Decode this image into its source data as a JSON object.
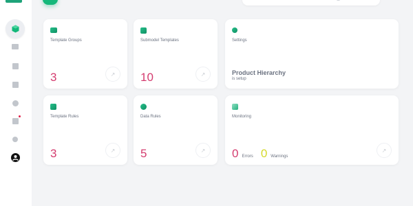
{
  "colors": {
    "accent": "#14b87a",
    "count": "#d43c6f",
    "warning": "#d4d92a"
  },
  "sidebar": {
    "items": [
      {
        "icon": "cube-icon",
        "active": true
      },
      {
        "icon": "folder-icon"
      },
      {
        "icon": "template-icon"
      },
      {
        "icon": "edit-icon"
      },
      {
        "icon": "data-icon"
      },
      {
        "icon": "notification-icon"
      },
      {
        "icon": "settings-icon"
      },
      {
        "icon": "user-avatar-icon"
      }
    ]
  },
  "cards": {
    "template_groups": {
      "label": "Template Groups",
      "count": "3",
      "icon": "folder-icon"
    },
    "submodel_templates": {
      "label": "Submodel Templates",
      "count": "10",
      "icon": "template-icon"
    },
    "settings": {
      "label": "Settings",
      "icon": "settings-icon",
      "title": "Product Hierarchy",
      "subtitle": "is setup"
    },
    "template_rules": {
      "label": "Template Rules",
      "count": "3",
      "icon": "edit-icon"
    },
    "data_rules": {
      "label": "Data Rules",
      "count": "5",
      "icon": "data-icon"
    },
    "monitoring": {
      "label": "Monitoring",
      "icon": "monitor-icon",
      "errors_count": "0",
      "errors_label": "Errors",
      "warnings_count": "0",
      "warnings_label": "Warnings"
    }
  },
  "arrow_glyph": "↗"
}
